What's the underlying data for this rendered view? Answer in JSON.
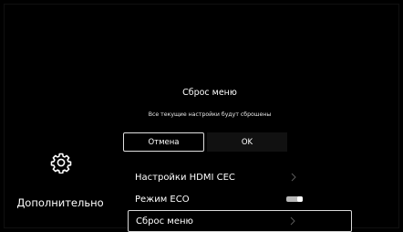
{
  "category": {
    "icon": "gear-icon",
    "label": "Дополнительно"
  },
  "settings": {
    "items": [
      {
        "label": "Настройки HDMI CEC",
        "control": "chevron-right-icon",
        "selected": false
      },
      {
        "label": "Режим ECO",
        "control": "toggle",
        "selected": false
      },
      {
        "label": "Сброс меню",
        "control": "chevron-right-icon",
        "selected": true
      }
    ]
  },
  "dialog": {
    "title": "Сброс меню",
    "message": "Все текущие настройки будут сброшены",
    "cancel_label": "Отмена",
    "ok_label": "OK"
  },
  "colors": {
    "background": "#000000",
    "text": "#ffffff",
    "focus_border": "#d8d8d8",
    "toggle": "#b8b8b8"
  }
}
